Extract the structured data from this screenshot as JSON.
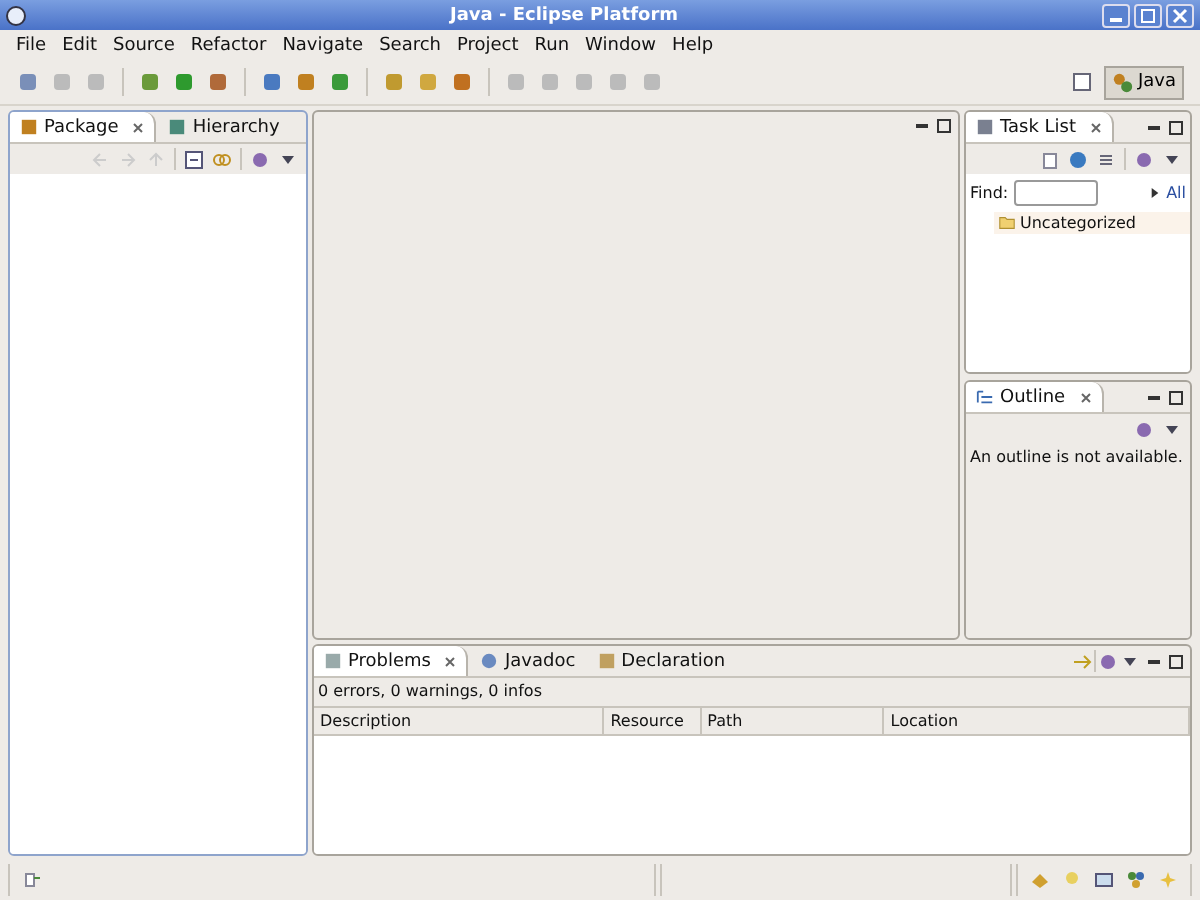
{
  "window": {
    "title": "Java - Eclipse Platform"
  },
  "menu": [
    "File",
    "Edit",
    "Source",
    "Refactor",
    "Navigate",
    "Search",
    "Project",
    "Run",
    "Window",
    "Help"
  ],
  "perspective": {
    "label": "Java",
    "selected": true
  },
  "left_view": {
    "tabs": [
      {
        "label": "Package",
        "selected": true
      },
      {
        "label": "Hierarchy",
        "selected": false
      }
    ]
  },
  "task_list": {
    "tab": "Task List",
    "find_label": "Find:",
    "all_link": "All",
    "items": [
      "Uncategorized"
    ]
  },
  "outline": {
    "tab": "Outline",
    "message": "An outline is not available."
  },
  "bottom_view": {
    "tabs": [
      {
        "label": "Problems",
        "selected": true
      },
      {
        "label": "Javadoc",
        "selected": false
      },
      {
        "label": "Declaration",
        "selected": false
      }
    ],
    "summary": "0 errors, 0 warnings, 0 infos",
    "columns": [
      "Description",
      "Resource",
      "Path",
      "Location"
    ]
  }
}
